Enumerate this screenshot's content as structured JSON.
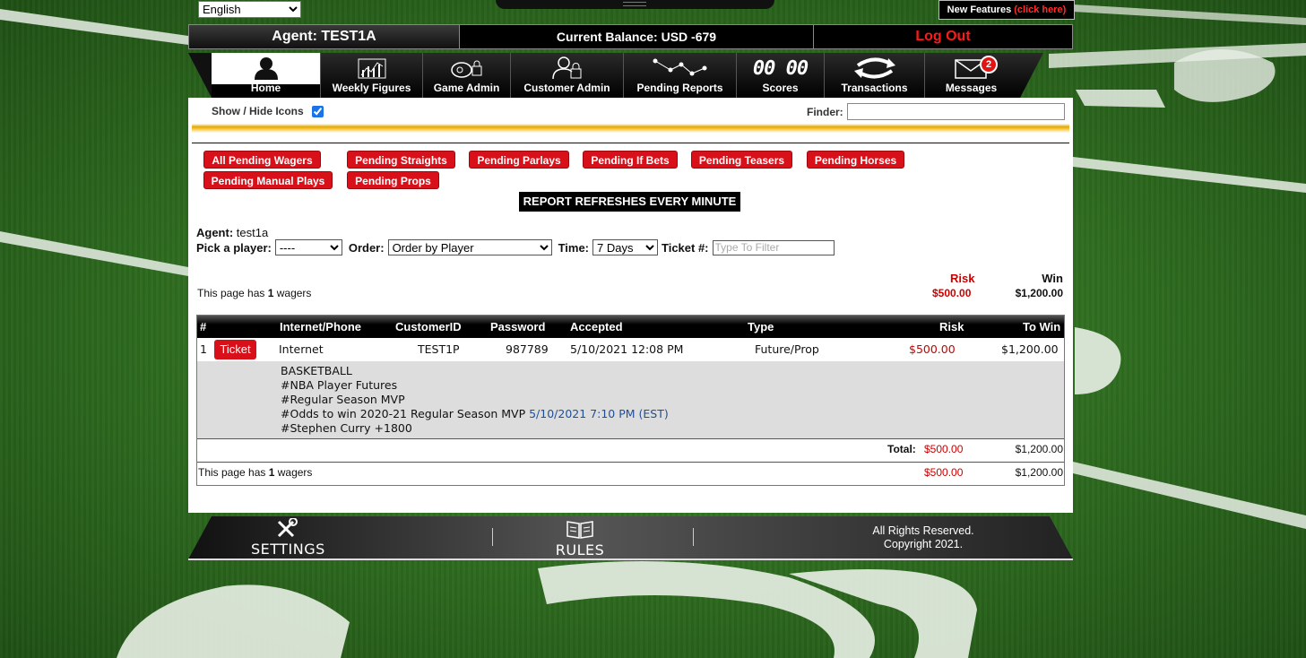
{
  "language": {
    "selected": "English"
  },
  "new_features": {
    "text": "New Features ",
    "link": "(click here)"
  },
  "agent_bar": {
    "agent": "Agent: TEST1A",
    "balance": "Current Balance: USD -679",
    "logout": "Log Out"
  },
  "nav": {
    "items": [
      {
        "label": "Home",
        "icon": "home-user-icon"
      },
      {
        "label": "Weekly Figures",
        "icon": "bar-chart-icon"
      },
      {
        "label": "Game Admin",
        "icon": "whistle-lock-icon"
      },
      {
        "label": "Customer Admin",
        "icon": "user-lock-icon"
      },
      {
        "label": "Pending Reports",
        "icon": "network-graph-icon"
      },
      {
        "label": "Scores",
        "icon": "scoreboard-icon",
        "glyph": "00 00"
      },
      {
        "label": "Transactions",
        "icon": "exchange-arrows-icon"
      },
      {
        "label": "Messages",
        "icon": "envelope-icon",
        "badge": "2"
      }
    ]
  },
  "toolbar": {
    "show_hide_label": "Show / Hide Icons",
    "show_hide_checked": true,
    "finder_label": "Finder:",
    "finder_value": ""
  },
  "report_buttons": [
    "All Pending Wagers",
    "Pending Straights",
    "Pending Parlays",
    "Pending If Bets",
    "Pending Teasers",
    "Pending Horses",
    "Pending Manual Plays",
    "Pending Props"
  ],
  "refresh_notice": "REPORT REFRESHES EVERY MINUTE",
  "filters": {
    "agent_label": "Agent:",
    "agent_value": "test1a",
    "player_label": "Pick a player:",
    "player_value": "----",
    "order_label": "Order:",
    "order_value": "Order by Player",
    "time_label": "Time:",
    "time_value": "7 Days",
    "ticket_label": "Ticket #:",
    "ticket_placeholder": "Type To Filter"
  },
  "summary": {
    "page_has": "This page has ",
    "count": "1",
    "wagers": " wagers",
    "risk_label": "Risk",
    "win_label": "Win",
    "risk_value": "$500.00",
    "win_value": "$1,200.00"
  },
  "table": {
    "columns": [
      "#",
      "Internet/Phone",
      "CustomerID",
      "Password",
      "Accepted",
      "Type",
      "Risk",
      "To Win"
    ],
    "rows": [
      {
        "num": "1",
        "ticket_label": "Ticket",
        "channel": "Internet",
        "customer_id": "TEST1P",
        "password": "987789",
        "accepted": "5/10/2021 12:08 PM",
        "type": "Future/Prop",
        "risk": "$500.00",
        "to_win": "$1,200.00",
        "details": {
          "sport": "BASKETBALL",
          "line1": "#NBA Player Futures",
          "line2": "#Regular Season MVP",
          "line3": "#Odds to win 2020-21 Regular Season MVP ",
          "line3_date": "5/10/2021 7:10 PM (EST)",
          "line4": "#Stephen Curry +1800"
        }
      }
    ],
    "total_label": "Total:",
    "total_risk": "$500.00",
    "total_win": "$1,200.00"
  },
  "footer": {
    "settings_label": "SETTINGS",
    "rules_label": "RULES",
    "copyright_line1": "All Rights Reserved.",
    "copyright_line2": "Copyright 2021."
  },
  "colors": {
    "accent_red": "#d8101a",
    "gold": "#e3a800",
    "turf_green": "#2f6a22"
  }
}
